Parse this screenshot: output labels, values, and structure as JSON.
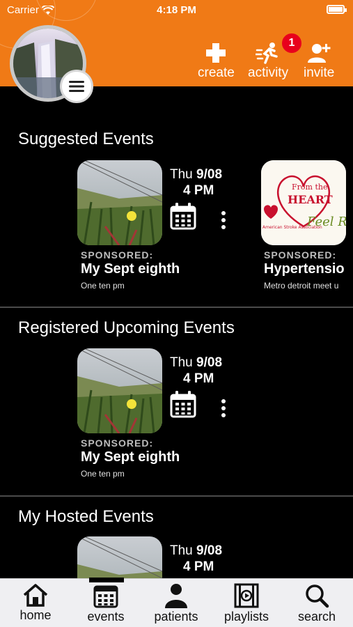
{
  "status_bar": {
    "carrier": "Carrier",
    "time": "4:18 PM"
  },
  "header": {
    "actions": [
      {
        "label": "create",
        "icon": "plus-icon"
      },
      {
        "label": "activity",
        "icon": "running-person-icon",
        "badge": "1"
      },
      {
        "label": "invite",
        "icon": "add-person-icon"
      }
    ],
    "accent_color": "#f07a16",
    "badge_color": "#e8001c"
  },
  "sections": [
    {
      "title": "Suggested Events",
      "events": [
        {
          "day": "Thu",
          "date": "9/08",
          "time": "4 PM",
          "sponsored": "SPONSORED:",
          "name": "My Sept eighth",
          "subtitle": "One ten pm"
        },
        {
          "sponsored": "SPONSORED:",
          "name": "Hypertensio",
          "subtitle": "Metro detroit meet u"
        }
      ]
    },
    {
      "title": "Registered Upcoming Events",
      "events": [
        {
          "day": "Thu",
          "date": "9/08",
          "time": "4 PM",
          "sponsored": "SPONSORED:",
          "name": "My Sept eighth",
          "subtitle": "One ten pm"
        }
      ]
    },
    {
      "title": "My Hosted Events",
      "events": [
        {
          "day": "Thu",
          "date": "9/08",
          "time": "4 PM"
        }
      ]
    }
  ],
  "promo_image": {
    "heart_text_1": "From the",
    "heart_text_2": "HEART",
    "org": "American Stroke Association",
    "script": "Feel Ri"
  },
  "tabbar": {
    "tabs": [
      {
        "label": "home",
        "icon": "home-icon"
      },
      {
        "label": "events",
        "icon": "calendar-icon"
      },
      {
        "label": "patients",
        "icon": "person-icon"
      },
      {
        "label": "playlists",
        "icon": "playlist-icon"
      },
      {
        "label": "search",
        "icon": "search-icon"
      }
    ],
    "active": "events"
  }
}
